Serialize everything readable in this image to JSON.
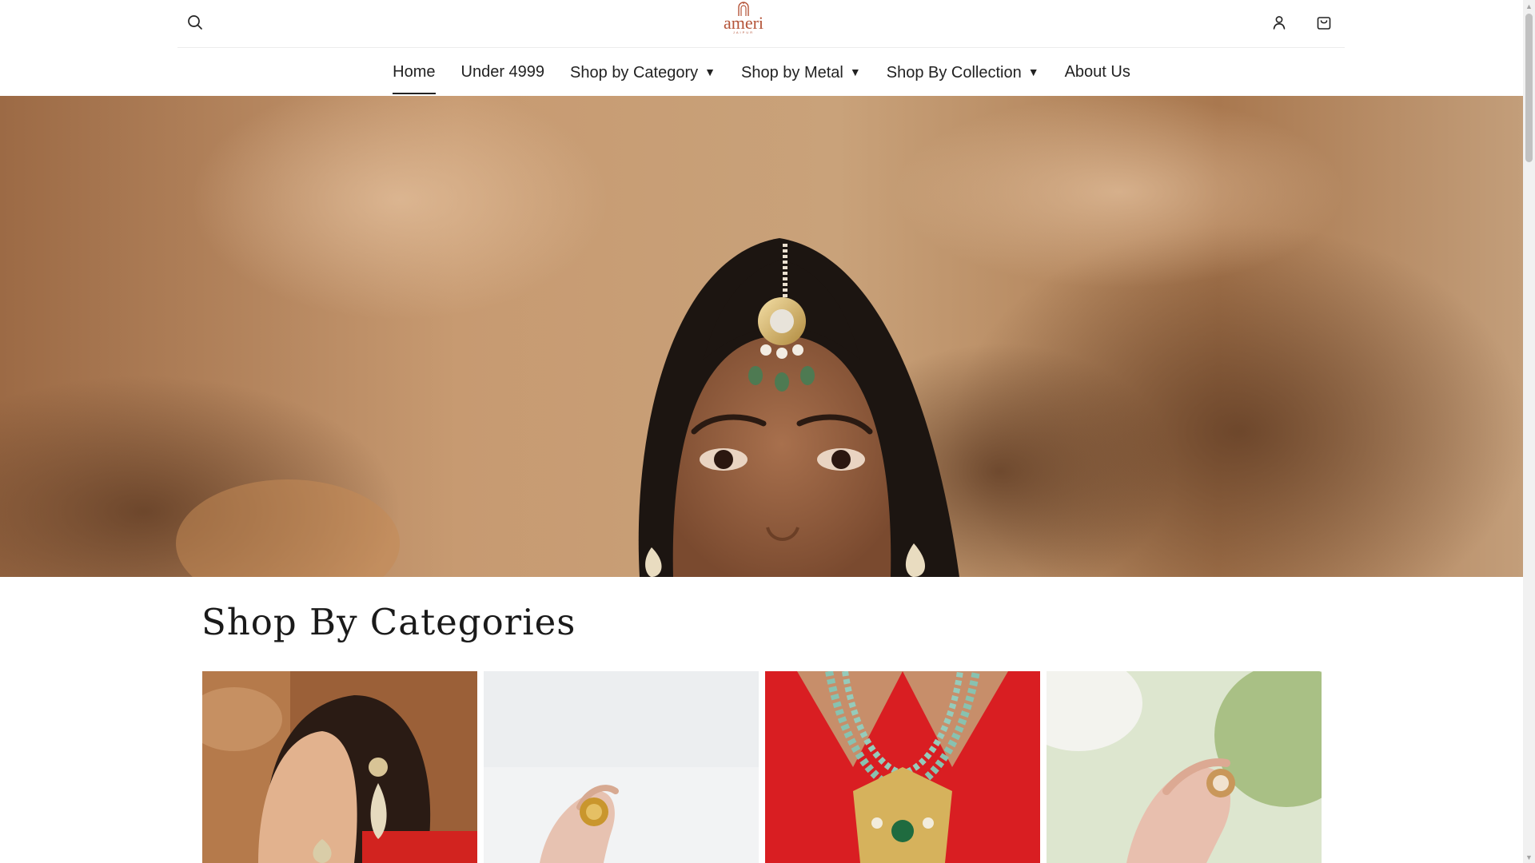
{
  "brand": {
    "logo_text": "ameri",
    "logo_subtext": "JAIPUR",
    "accent_color": "#b5553a"
  },
  "header": {
    "search_icon": "search-icon",
    "account_icon": "user-icon",
    "cart_icon": "shopping-bag-icon"
  },
  "nav": {
    "items": [
      {
        "label": "Home",
        "active": true,
        "dropdown": false
      },
      {
        "label": "Under 4999",
        "active": false,
        "dropdown": false
      },
      {
        "label": "Shop by Category",
        "active": false,
        "dropdown": true
      },
      {
        "label": "Shop by Metal",
        "active": false,
        "dropdown": true
      },
      {
        "label": "Shop By Collection",
        "active": false,
        "dropdown": true
      },
      {
        "label": "About Us",
        "active": false,
        "dropdown": false
      }
    ],
    "caret_glyph": "▼"
  },
  "hero": {
    "image": "model-wearing-maang-tikka"
  },
  "categories_section": {
    "title": "Shop By Categories",
    "cards": [
      {
        "image": "woman-wearing-earrings"
      },
      {
        "image": "hand-with-gold-ring"
      },
      {
        "image": "emerald-bead-necklace"
      },
      {
        "image": "hands-with-kundan-ring"
      }
    ]
  },
  "scrollbar": {
    "up_glyph": "▲",
    "down_glyph": "▼"
  }
}
